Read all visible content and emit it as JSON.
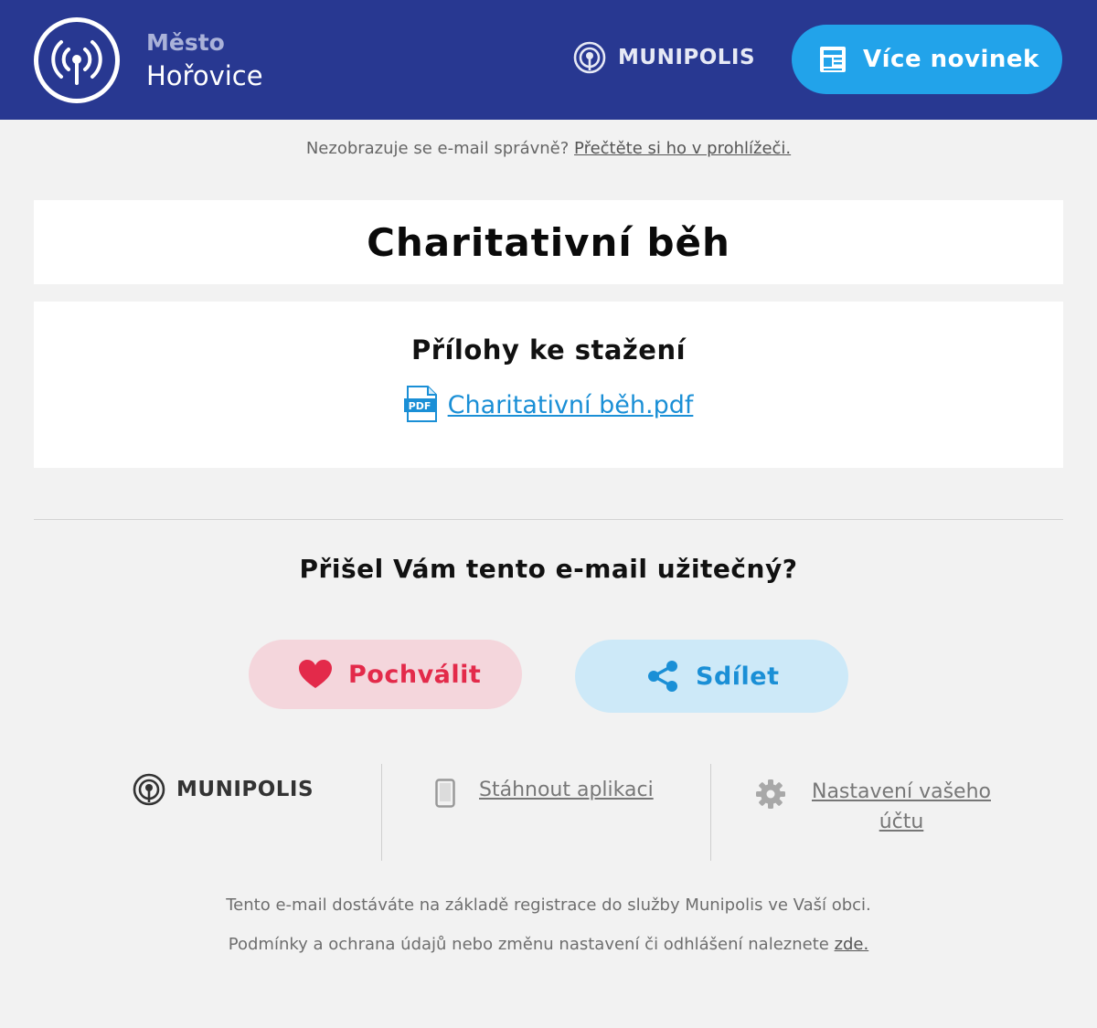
{
  "header": {
    "town_prefix": "Město",
    "town_name": "Hořovice",
    "brand": "MUNIPOLIS",
    "more_news_label": "Více novinek",
    "colors": {
      "background": "#283891",
      "button": "#22a3ea"
    },
    "icons": {
      "logo": "broadcast-antenna-icon",
      "brand": "munipolis-logo-icon",
      "more_news": "newspaper-icon"
    }
  },
  "preheader": {
    "text": "Nezobrazuje se e-mail správně?",
    "link": "Přečtěte si ho v prohlížeči."
  },
  "article": {
    "title": "Charitativní běh"
  },
  "attachments": {
    "heading": "Přílohy ke stažení",
    "items": [
      {
        "name": "Charitativní běh.pdf",
        "icon": "pdf-file-icon",
        "icon_text": "PDF"
      }
    ]
  },
  "feedback": {
    "question": "Přišel Vám tento e-mail užitečný?",
    "praise_label": "Pochválit",
    "share_label": "Sdílet",
    "colors": {
      "praise": "#e32a4a",
      "share": "#1a8fd6"
    },
    "icons": {
      "praise": "heart-icon",
      "share": "share-icon"
    }
  },
  "footer": {
    "brand": "MUNIPOLIS",
    "app_link": "Stáhnout aplikaci",
    "account_link": "Nastavení vašeho účtu",
    "note": "Tento e-mail dostáváte na základě registrace do služby Munipolis ve Vaší obci.",
    "terms_text": "Podmínky a ochrana údajů nebo změnu nastavení či odhlášení naleznete",
    "terms_link": "zde.",
    "icons": {
      "brand": "munipolis-logo-icon",
      "app": "smartphone-icon",
      "account": "gear-icon"
    }
  }
}
